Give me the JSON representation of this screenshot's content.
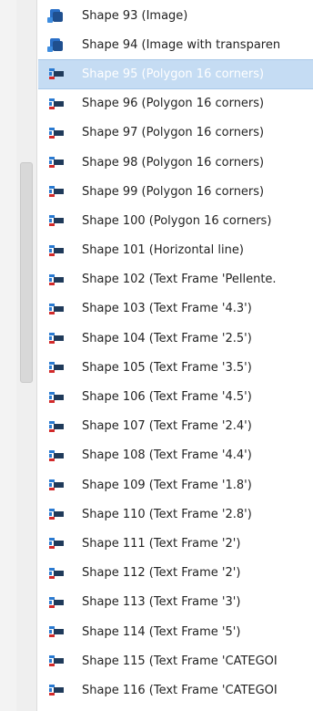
{
  "items": [
    {
      "label": "Shape 93 (Image)",
      "icon": "image-icon",
      "selected": false
    },
    {
      "label": "Shape 94 (Image with transparen",
      "icon": "image-icon",
      "selected": false
    },
    {
      "label": "Shape 95 (Polygon 16 corners)",
      "icon": "shape-icon",
      "selected": true
    },
    {
      "label": "Shape 96 (Polygon 16 corners)",
      "icon": "shape-icon",
      "selected": false
    },
    {
      "label": "Shape 97 (Polygon 16 corners)",
      "icon": "shape-icon",
      "selected": false
    },
    {
      "label": "Shape 98 (Polygon 16 corners)",
      "icon": "shape-icon",
      "selected": false
    },
    {
      "label": "Shape 99 (Polygon 16 corners)",
      "icon": "shape-icon",
      "selected": false
    },
    {
      "label": "Shape 100 (Polygon 16 corners)",
      "icon": "shape-icon",
      "selected": false
    },
    {
      "label": "Shape 101 (Horizontal line)",
      "icon": "shape-icon",
      "selected": false
    },
    {
      "label": "Shape 102 (Text Frame 'Pellente.",
      "icon": "shape-icon",
      "selected": false
    },
    {
      "label": "Shape 103 (Text Frame '4.3')",
      "icon": "shape-icon",
      "selected": false
    },
    {
      "label": "Shape 104 (Text Frame '2.5')",
      "icon": "shape-icon",
      "selected": false
    },
    {
      "label": "Shape 105 (Text Frame '3.5')",
      "icon": "shape-icon",
      "selected": false
    },
    {
      "label": "Shape 106 (Text Frame '4.5')",
      "icon": "shape-icon",
      "selected": false
    },
    {
      "label": "Shape 107 (Text Frame '2.4')",
      "icon": "shape-icon",
      "selected": false
    },
    {
      "label": "Shape 108 (Text Frame '4.4')",
      "icon": "shape-icon",
      "selected": false
    },
    {
      "label": "Shape 109 (Text Frame '1.8')",
      "icon": "shape-icon",
      "selected": false
    },
    {
      "label": "Shape 110 (Text Frame '2.8')",
      "icon": "shape-icon",
      "selected": false
    },
    {
      "label": "Shape 111 (Text Frame '2')",
      "icon": "shape-icon",
      "selected": false
    },
    {
      "label": "Shape 112 (Text Frame '2')",
      "icon": "shape-icon",
      "selected": false
    },
    {
      "label": "Shape 113 (Text Frame '3')",
      "icon": "shape-icon",
      "selected": false
    },
    {
      "label": "Shape 114 (Text Frame '5')",
      "icon": "shape-icon",
      "selected": false
    },
    {
      "label": "Shape 115 (Text Frame 'CATEGOI",
      "icon": "shape-icon",
      "selected": false
    },
    {
      "label": "Shape 116 (Text Frame 'CATEGOI",
      "icon": "shape-icon",
      "selected": false
    }
  ],
  "colors": {
    "selection": "#c5dcf3",
    "icon_blue": "#2a7ad1",
    "icon_dark": "#1f3a5a",
    "icon_red": "#d22a2a"
  }
}
